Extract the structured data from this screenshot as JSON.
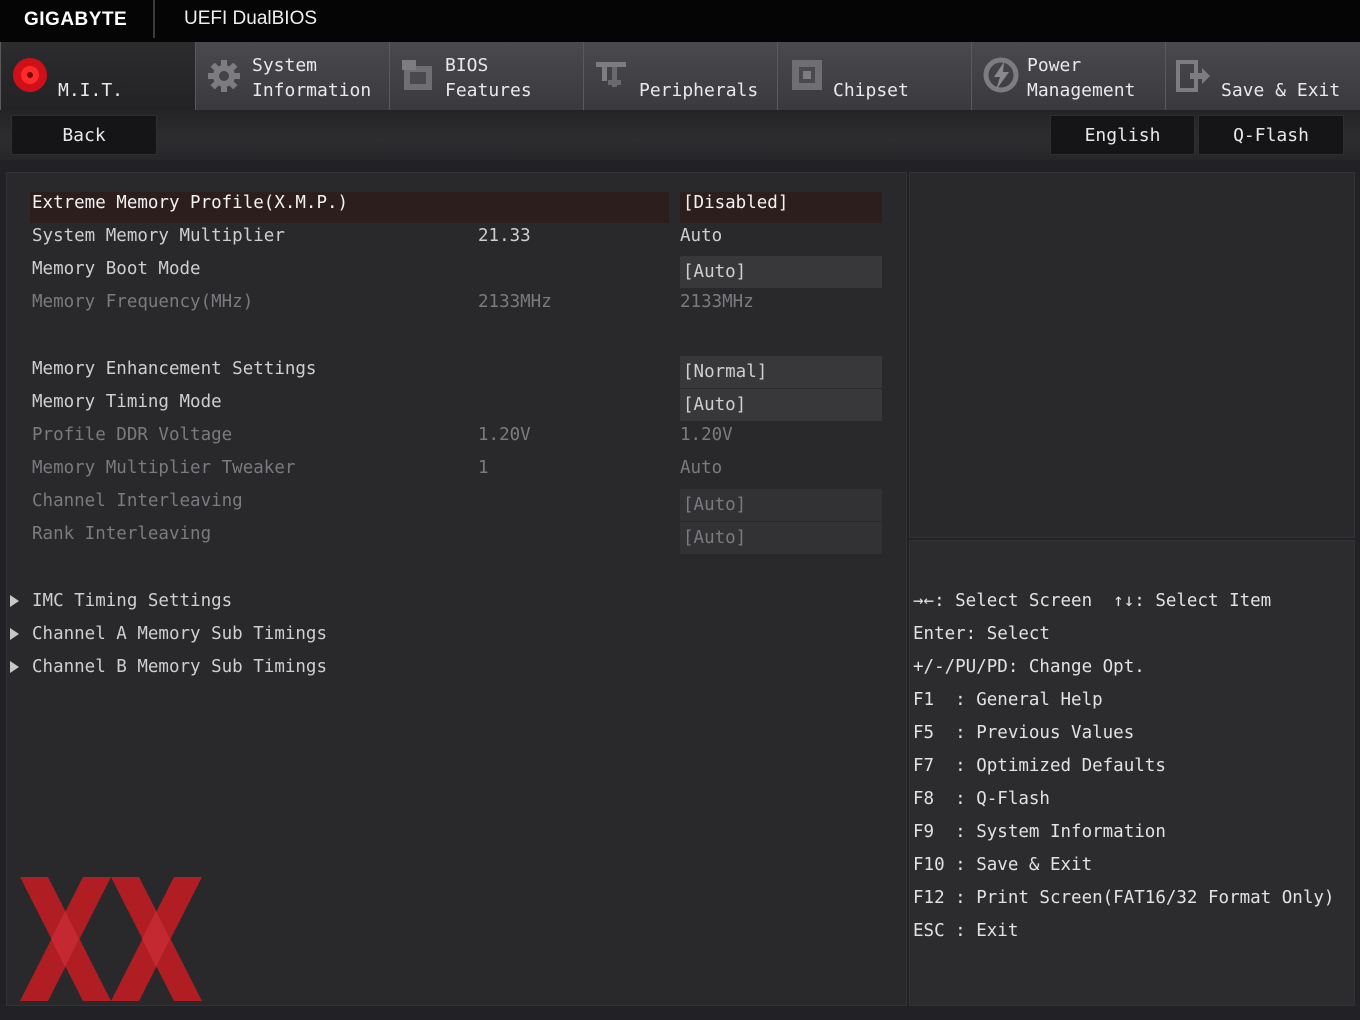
{
  "header": {
    "brand": "GIGABYTE",
    "title": "UEFI DualBIOS"
  },
  "tabs": [
    {
      "line1": "",
      "line2": "M.I.T.",
      "icon": "mit-red-circle-icon",
      "active": true
    },
    {
      "line1": "System",
      "line2": "Information",
      "icon": "gear-icon"
    },
    {
      "line1": "BIOS",
      "line2": "Features",
      "icon": "chip-icon"
    },
    {
      "line1": "",
      "line2": "Peripherals",
      "icon": "peripherals-icon"
    },
    {
      "line1": "",
      "line2": "Chipset",
      "icon": "chipset-icon"
    },
    {
      "line1": "Power",
      "line2": "Management",
      "icon": "power-icon"
    },
    {
      "line1": "",
      "line2": "Save & Exit",
      "icon": "exit-door-icon"
    }
  ],
  "subbar": {
    "back": "Back",
    "language": "English",
    "qflash": "Q-Flash"
  },
  "settings": [
    {
      "label": "Extreme Memory Profile(X.M.P.)",
      "current": "",
      "value": "[Disabled]",
      "state": "selected"
    },
    {
      "label": "System Memory Multiplier",
      "current": "21.33",
      "value": "Auto",
      "state": "normal"
    },
    {
      "label": "Memory Boot Mode",
      "current": "",
      "value": "[Auto]",
      "state": "normal"
    },
    {
      "label": "Memory Frequency(MHz)",
      "current": "2133MHz",
      "value": "2133MHz",
      "state": "dim"
    },
    {
      "label": "Memory Enhancement Settings",
      "current": "",
      "value": "[Normal]",
      "state": "normal"
    },
    {
      "label": "Memory Timing Mode",
      "current": "",
      "value": "[Auto]",
      "state": "normal"
    },
    {
      "label": "Profile DDR Voltage",
      "current": "1.20V",
      "value": "1.20V",
      "state": "dim"
    },
    {
      "label": "Memory Multiplier Tweaker",
      "current": "1",
      "value": "Auto",
      "state": "dim"
    },
    {
      "label": "Channel Interleaving",
      "current": "",
      "value": "[Auto]",
      "state": "dim"
    },
    {
      "label": "Rank Interleaving",
      "current": "",
      "value": "[Auto]",
      "state": "dim"
    }
  ],
  "submenus": [
    "IMC Timing Settings",
    "Channel A Memory Sub Timings",
    "Channel B Memory Sub Timings"
  ],
  "help": [
    "→←: Select Screen  ↑↓: Select Item",
    "Enter: Select",
    "+/-/PU/PD: Change Opt.",
    "F1  : General Help",
    "F5  : Previous Values",
    "F7  : Optimized Defaults",
    "F8  : Q-Flash",
    "F9  : System Information",
    "F10 : Save & Exit",
    "F12 : Print Screen(FAT16/32 Format Only)",
    "ESC : Exit"
  ],
  "colors": {
    "accent_red": "#c0202a",
    "xmp_highlight": "#2d1e1e"
  }
}
